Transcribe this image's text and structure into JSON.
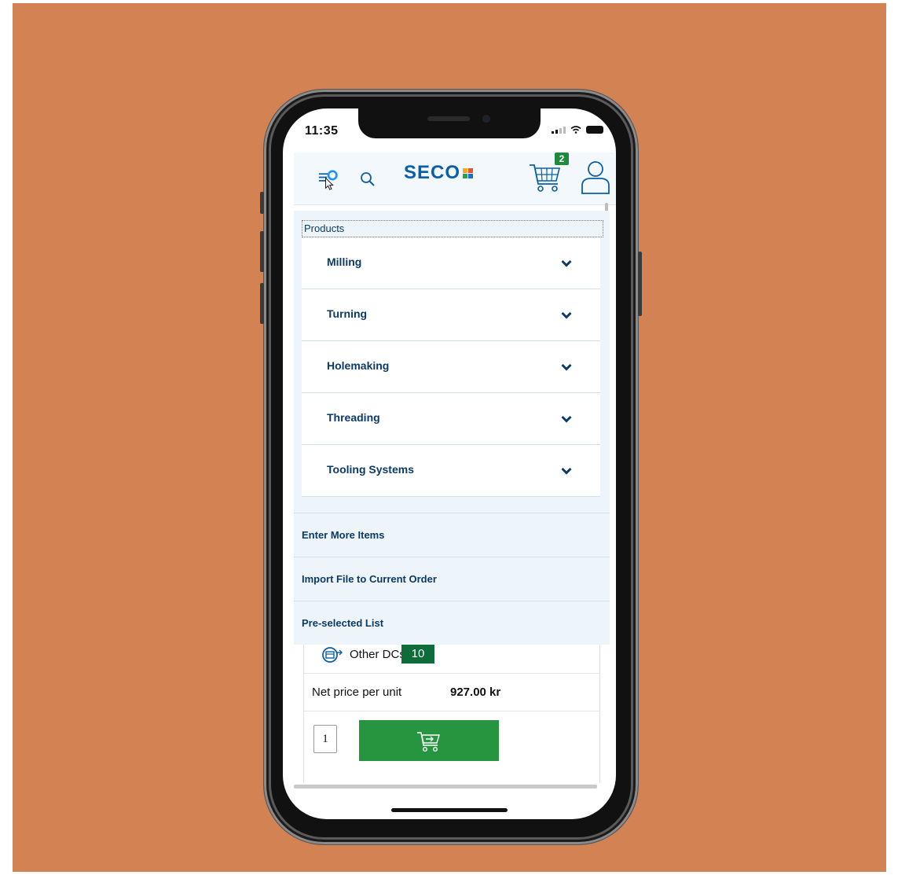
{
  "status_bar": {
    "time": "11:35"
  },
  "header": {
    "logo_text": "SECO",
    "cart_count": "2",
    "brand_color": "#0b5fa8",
    "icons": [
      "menu-icon",
      "search-icon",
      "cart-icon",
      "user-icon"
    ]
  },
  "menu": {
    "section_label": "Products",
    "categories": [
      {
        "label": "Milling"
      },
      {
        "label": "Turning"
      },
      {
        "label": "Holemaking"
      },
      {
        "label": "Threading"
      },
      {
        "label": "Tooling Systems"
      }
    ],
    "links": [
      {
        "label": "Enter More Items"
      },
      {
        "label": "Import File to Current Order"
      },
      {
        "label": "Pre-selected List"
      }
    ]
  },
  "product": {
    "stock_label": "Other DCs",
    "stock_count": "10",
    "price_label": "Net price per unit",
    "price_value": "927.00 kr",
    "quantity": "1",
    "add_to_cart_color": "#27943f"
  }
}
